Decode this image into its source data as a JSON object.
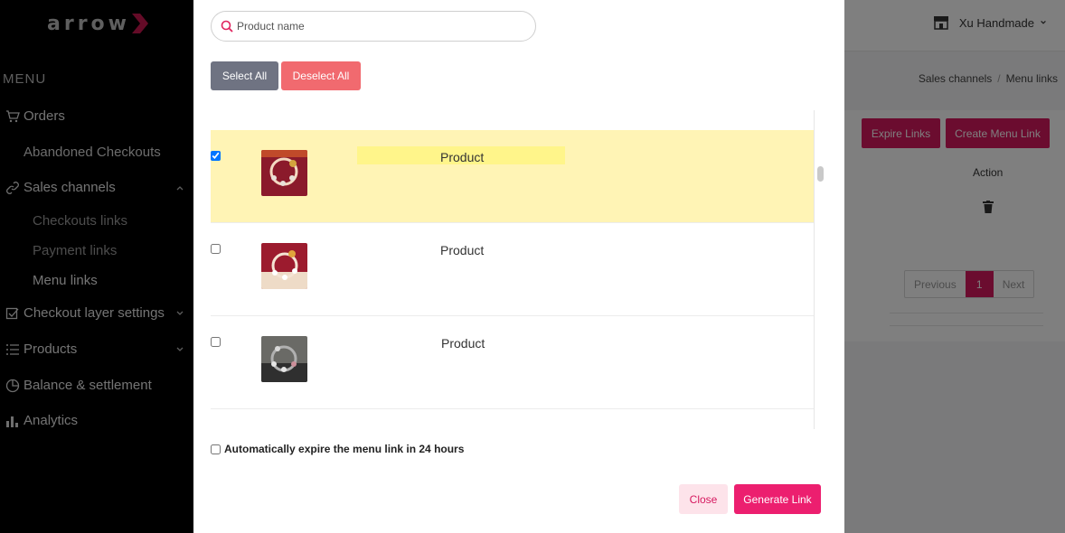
{
  "sidebar": {
    "logo_text": "arrow",
    "menu_heading": "MENU",
    "items": {
      "orders": "Orders",
      "abandoned": "Abandoned Checkouts",
      "sales_channels": "Sales channels",
      "checkouts_links": "Checkouts links",
      "payment_links": "Payment links",
      "menu_links": "Menu links",
      "checkout_layer": "Checkout layer settings",
      "products": "Products",
      "balance": "Balance & settlement",
      "analytics": "Analytics"
    }
  },
  "header": {
    "store_name": "Xu Handmade"
  },
  "breadcrumb": {
    "parent": "Sales channels",
    "sep": "/",
    "current": "Menu links"
  },
  "page": {
    "expire_button": "Expire Links",
    "create_button": "Create Menu Link",
    "action_header": "Action",
    "pagination": {
      "previous": "Previous",
      "current": "1",
      "next": "Next"
    }
  },
  "modal": {
    "search_placeholder": "Product name",
    "select_all": "Select All",
    "deselect_all": "Deselect All",
    "products": [
      {
        "name": "Product",
        "checked": true
      },
      {
        "name": "Product",
        "checked": false
      },
      {
        "name": "Product",
        "checked": false
      }
    ],
    "auto_expire_label": "Automatically expire the menu link in 24 hours",
    "close_button": "Close",
    "generate_button": "Generate Link"
  },
  "colors": {
    "accent": "#ec1f6f",
    "selected_row": "#fff4b5",
    "sidebar_bg": "#000000"
  }
}
